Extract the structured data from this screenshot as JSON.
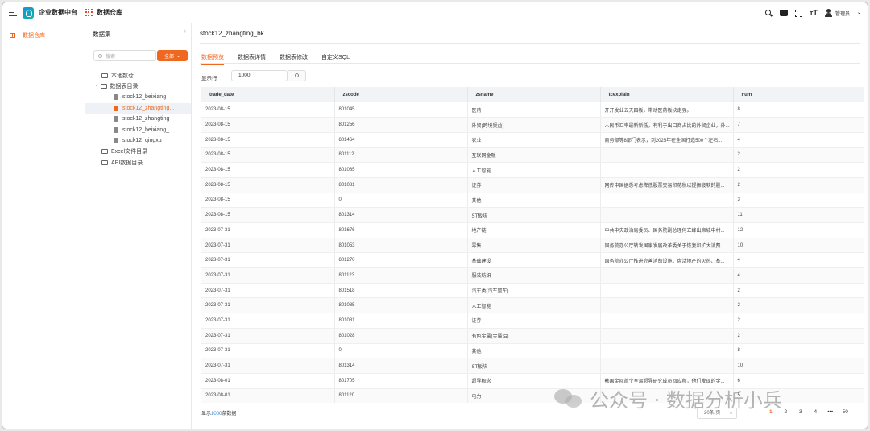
{
  "header": {
    "app_title": "企业数据中台",
    "module_title": "数据仓库",
    "username": "管理员"
  },
  "sidebar": {
    "items": [
      {
        "label": "数据仓库",
        "icon": "table-icon",
        "active": true
      }
    ]
  },
  "tree": {
    "title": "数据集",
    "add_symbol": "+",
    "search_placeholder": "搜索",
    "filter_label": "全部",
    "nodes": [
      {
        "label": "本地数仓"
      },
      {
        "label": "数据表目录"
      },
      {
        "label": "stock12_beixiang"
      },
      {
        "label": "stock12_zhangting..."
      },
      {
        "label": "stock12_zhangting"
      },
      {
        "label": "stock12_beixiang_..."
      },
      {
        "label": "stock12_qingxu"
      },
      {
        "label": "Excel文件目录"
      },
      {
        "label": "API数据目录"
      }
    ]
  },
  "main": {
    "table_name": "stock12_zhangting_bk",
    "tabs": [
      {
        "label": "数据预览",
        "active": true
      },
      {
        "label": "数据表详情"
      },
      {
        "label": "数据表修改"
      },
      {
        "label": "自定义SQL"
      }
    ],
    "rows_label": "显示行",
    "rows_value": "1000"
  },
  "table": {
    "columns": [
      "trade_date",
      "zscode",
      "zsname",
      "tcexplain",
      "num"
    ],
    "rows": [
      [
        "2023-08-15",
        "801045",
        "医药",
        "开开发业五天四板，带动医药板块走强。",
        "8"
      ],
      [
        "2023-08-15",
        "801256",
        "外贸(跨境受益)",
        "人民币汇率最新新低，有利于出口商占比的外贸企业，外...",
        "7"
      ],
      [
        "2023-08-15",
        "801464",
        "农业",
        "商务部等8部门表示，到2025年在全国打造500个左右...",
        "4"
      ],
      [
        "2023-08-15",
        "801112",
        "互联网金融",
        "",
        "2"
      ],
      [
        "2023-08-15",
        "801085",
        "人工智能",
        "",
        "2"
      ],
      [
        "2023-08-15",
        "801081",
        "证券",
        "网传中国据悉考虑降低股票交易印花税以提振疲软的股...",
        "2"
      ],
      [
        "2023-08-15",
        "0",
        "其他",
        "",
        "3"
      ],
      [
        "2023-08-15",
        "801314",
        "ST板块",
        "",
        "11"
      ],
      [
        "2023-07-31",
        "801676",
        "地产链",
        "中共中央政治局委员、国务院副总理何立峰出席城中村...",
        "12"
      ],
      [
        "2023-07-31",
        "801053",
        "零售",
        "国务院办公厅转发国家发展改革委关于恢复和扩大消费...",
        "10"
      ],
      [
        "2023-07-31",
        "801270",
        "基础建设",
        "国务院办公厅推进完善消费设施，盘活地产的火热、基...",
        "4"
      ],
      [
        "2023-07-31",
        "801123",
        "服装纺织",
        "",
        "4"
      ],
      [
        "2023-07-31",
        "801518",
        "汽车类(汽车整车)",
        "",
        "2"
      ],
      [
        "2023-07-31",
        "801085",
        "人工智能",
        "",
        "2"
      ],
      [
        "2023-07-31",
        "801081",
        "证券",
        "",
        "2"
      ],
      [
        "2023-07-31",
        "801028",
        "有色金属(金属铝)",
        "",
        "2"
      ],
      [
        "2023-07-31",
        "0",
        "其他",
        "",
        "8"
      ],
      [
        "2023-07-31",
        "801314",
        "ST板块",
        "",
        "10"
      ],
      [
        "2023-08-01",
        "801705",
        "超导概念",
        "韩国金际首个室温超导研究成员回应称，他们发现的金...",
        "6"
      ],
      [
        "2023-08-01",
        "801120",
        "电力",
        "",
        "5"
      ]
    ]
  },
  "footer": {
    "count_prefix": "显示",
    "count_value": "1000",
    "count_suffix": "条数据",
    "page_size": "20条/页",
    "pages": [
      "1",
      "2",
      "3",
      "4",
      "•••",
      "50"
    ],
    "prev_symbol": "‹",
    "next_symbol": "›"
  },
  "watermark": "公众号 · 数据分析小兵",
  "colors": {
    "accent": "#f0671f",
    "link": "#2f7fd8"
  }
}
